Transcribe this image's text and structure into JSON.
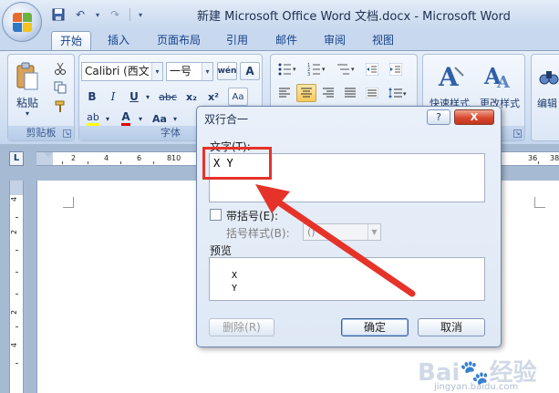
{
  "window": {
    "title": "新建 Microsoft Office Word 文档.docx - Microsoft Word"
  },
  "quick_access": {
    "undo_glyph": "↶",
    "redo_glyph": "↷",
    "more_glyph": "▾"
  },
  "tabs": [
    {
      "label": "开始",
      "active": true
    },
    {
      "label": "插入"
    },
    {
      "label": "页面布局"
    },
    {
      "label": "引用"
    },
    {
      "label": "邮件"
    },
    {
      "label": "审阅"
    },
    {
      "label": "视图"
    }
  ],
  "ribbon": {
    "clipboard": {
      "label": "剪贴板",
      "paste_label": "粘贴"
    },
    "font": {
      "label": "字体",
      "font_name": "Calibri (西文",
      "font_size": "一号",
      "wen_glyph": "wén",
      "char_border_glyph": "A",
      "bold": "B",
      "italic": "I",
      "underline": "U",
      "strike": "abc",
      "subscript": "x₂",
      "superscript": "x²",
      "clear_glyph": "Aa",
      "highlight_glyph": "ab",
      "font_color_glyph": "A",
      "case_glyph": "Aa"
    },
    "styles": {
      "quick_style_label": "快速样式",
      "change_style_label": "更改样式"
    },
    "editing": {
      "label": "编辑"
    },
    "colors": {
      "highlight": "#ffff00",
      "font_color": "#e00000"
    }
  },
  "ruler": {
    "corner_glyph": "L",
    "h_ticks": [
      "2",
      "4",
      "6",
      "8",
      "10",
      "36",
      "38"
    ],
    "v_ticks": [
      "4",
      "2",
      "2",
      "4"
    ]
  },
  "dialog": {
    "title": "双行合一",
    "help": "?",
    "close": "X",
    "text_label": "文字(T):",
    "text_value": "X Y",
    "bracket_checkbox_label": "带括号(E):",
    "bracket_checked": false,
    "bracket_style_label": "括号样式(B):",
    "bracket_style_value": "()",
    "preview_label": "预览",
    "preview_line1": "X",
    "preview_line2": "Y",
    "delete_button": "删除(R)",
    "ok_button": "确定",
    "cancel_button": "取消"
  },
  "annotation": {
    "color": "#e5332a"
  },
  "watermark": {
    "logo": "Bai🐾经验",
    "site": "jingyan.baidu.com"
  }
}
